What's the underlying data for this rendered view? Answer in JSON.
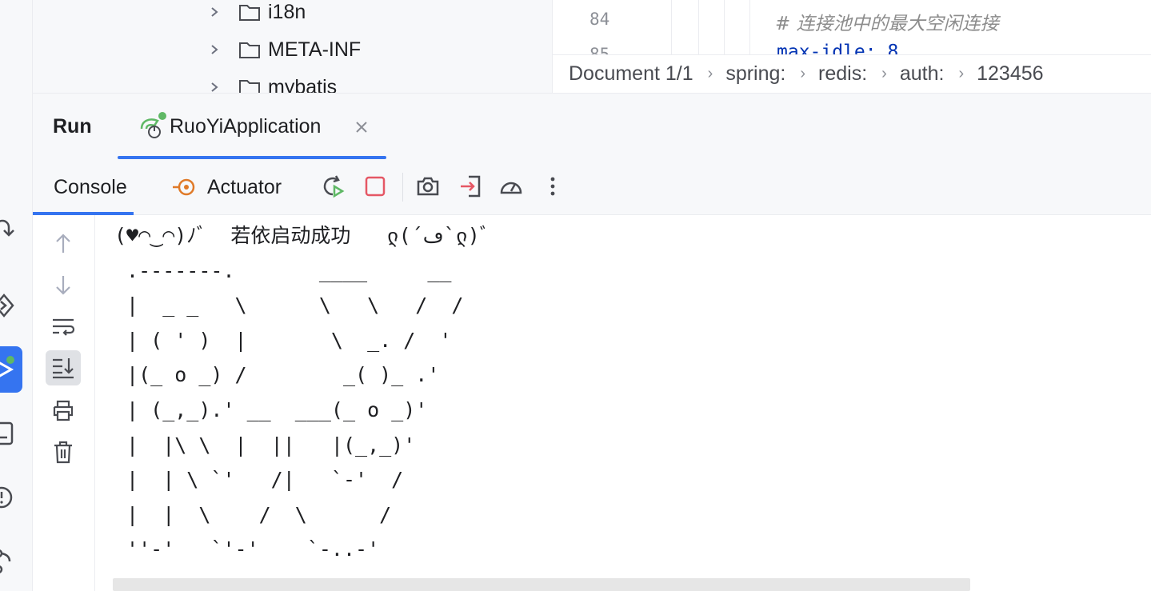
{
  "project_tree": {
    "items": [
      {
        "label": "i18n"
      },
      {
        "label": "META-INF"
      },
      {
        "label": "mybatis"
      }
    ]
  },
  "editor": {
    "line_numbers": [
      "84",
      "85"
    ],
    "comment_line": "#  连接池中的最大空闲连接",
    "code_line": "max-idle: 8",
    "breadcrumbs": [
      "Document 1/1",
      "spring:",
      "redis:",
      "auth:",
      "123456"
    ]
  },
  "run_panel": {
    "title": "Run",
    "tab_label": "RuoYiApplication",
    "toolbar": {
      "console_tab": "Console",
      "actuator_tab": "Actuator"
    },
    "console_lines": [
      "(♥◠‿◠)ﾉﾞ  若依启动成功   ლ(´ڡ`ლ)ﾞ",
      " .-------.       ____     __",
      " |  _ _   \\      \\   \\   /  /",
      " | ( ' )  |       \\  _. /  '",
      " |(_ o _) /        _( )_ .'",
      " | (_,_).' __  ___(_ o _)'",
      " |  |\\ \\  |  ||   |(_,_)'",
      " |  | \\ `'   /|   `-'  /",
      " |  |  \\    /  \\      /",
      " ''-'   `'-'    `-..-'"
    ]
  },
  "colors": {
    "accent": "#3574f0",
    "stop_red": "#e55765",
    "run_green": "#5fb865",
    "actuator_orange": "#e07a28"
  }
}
